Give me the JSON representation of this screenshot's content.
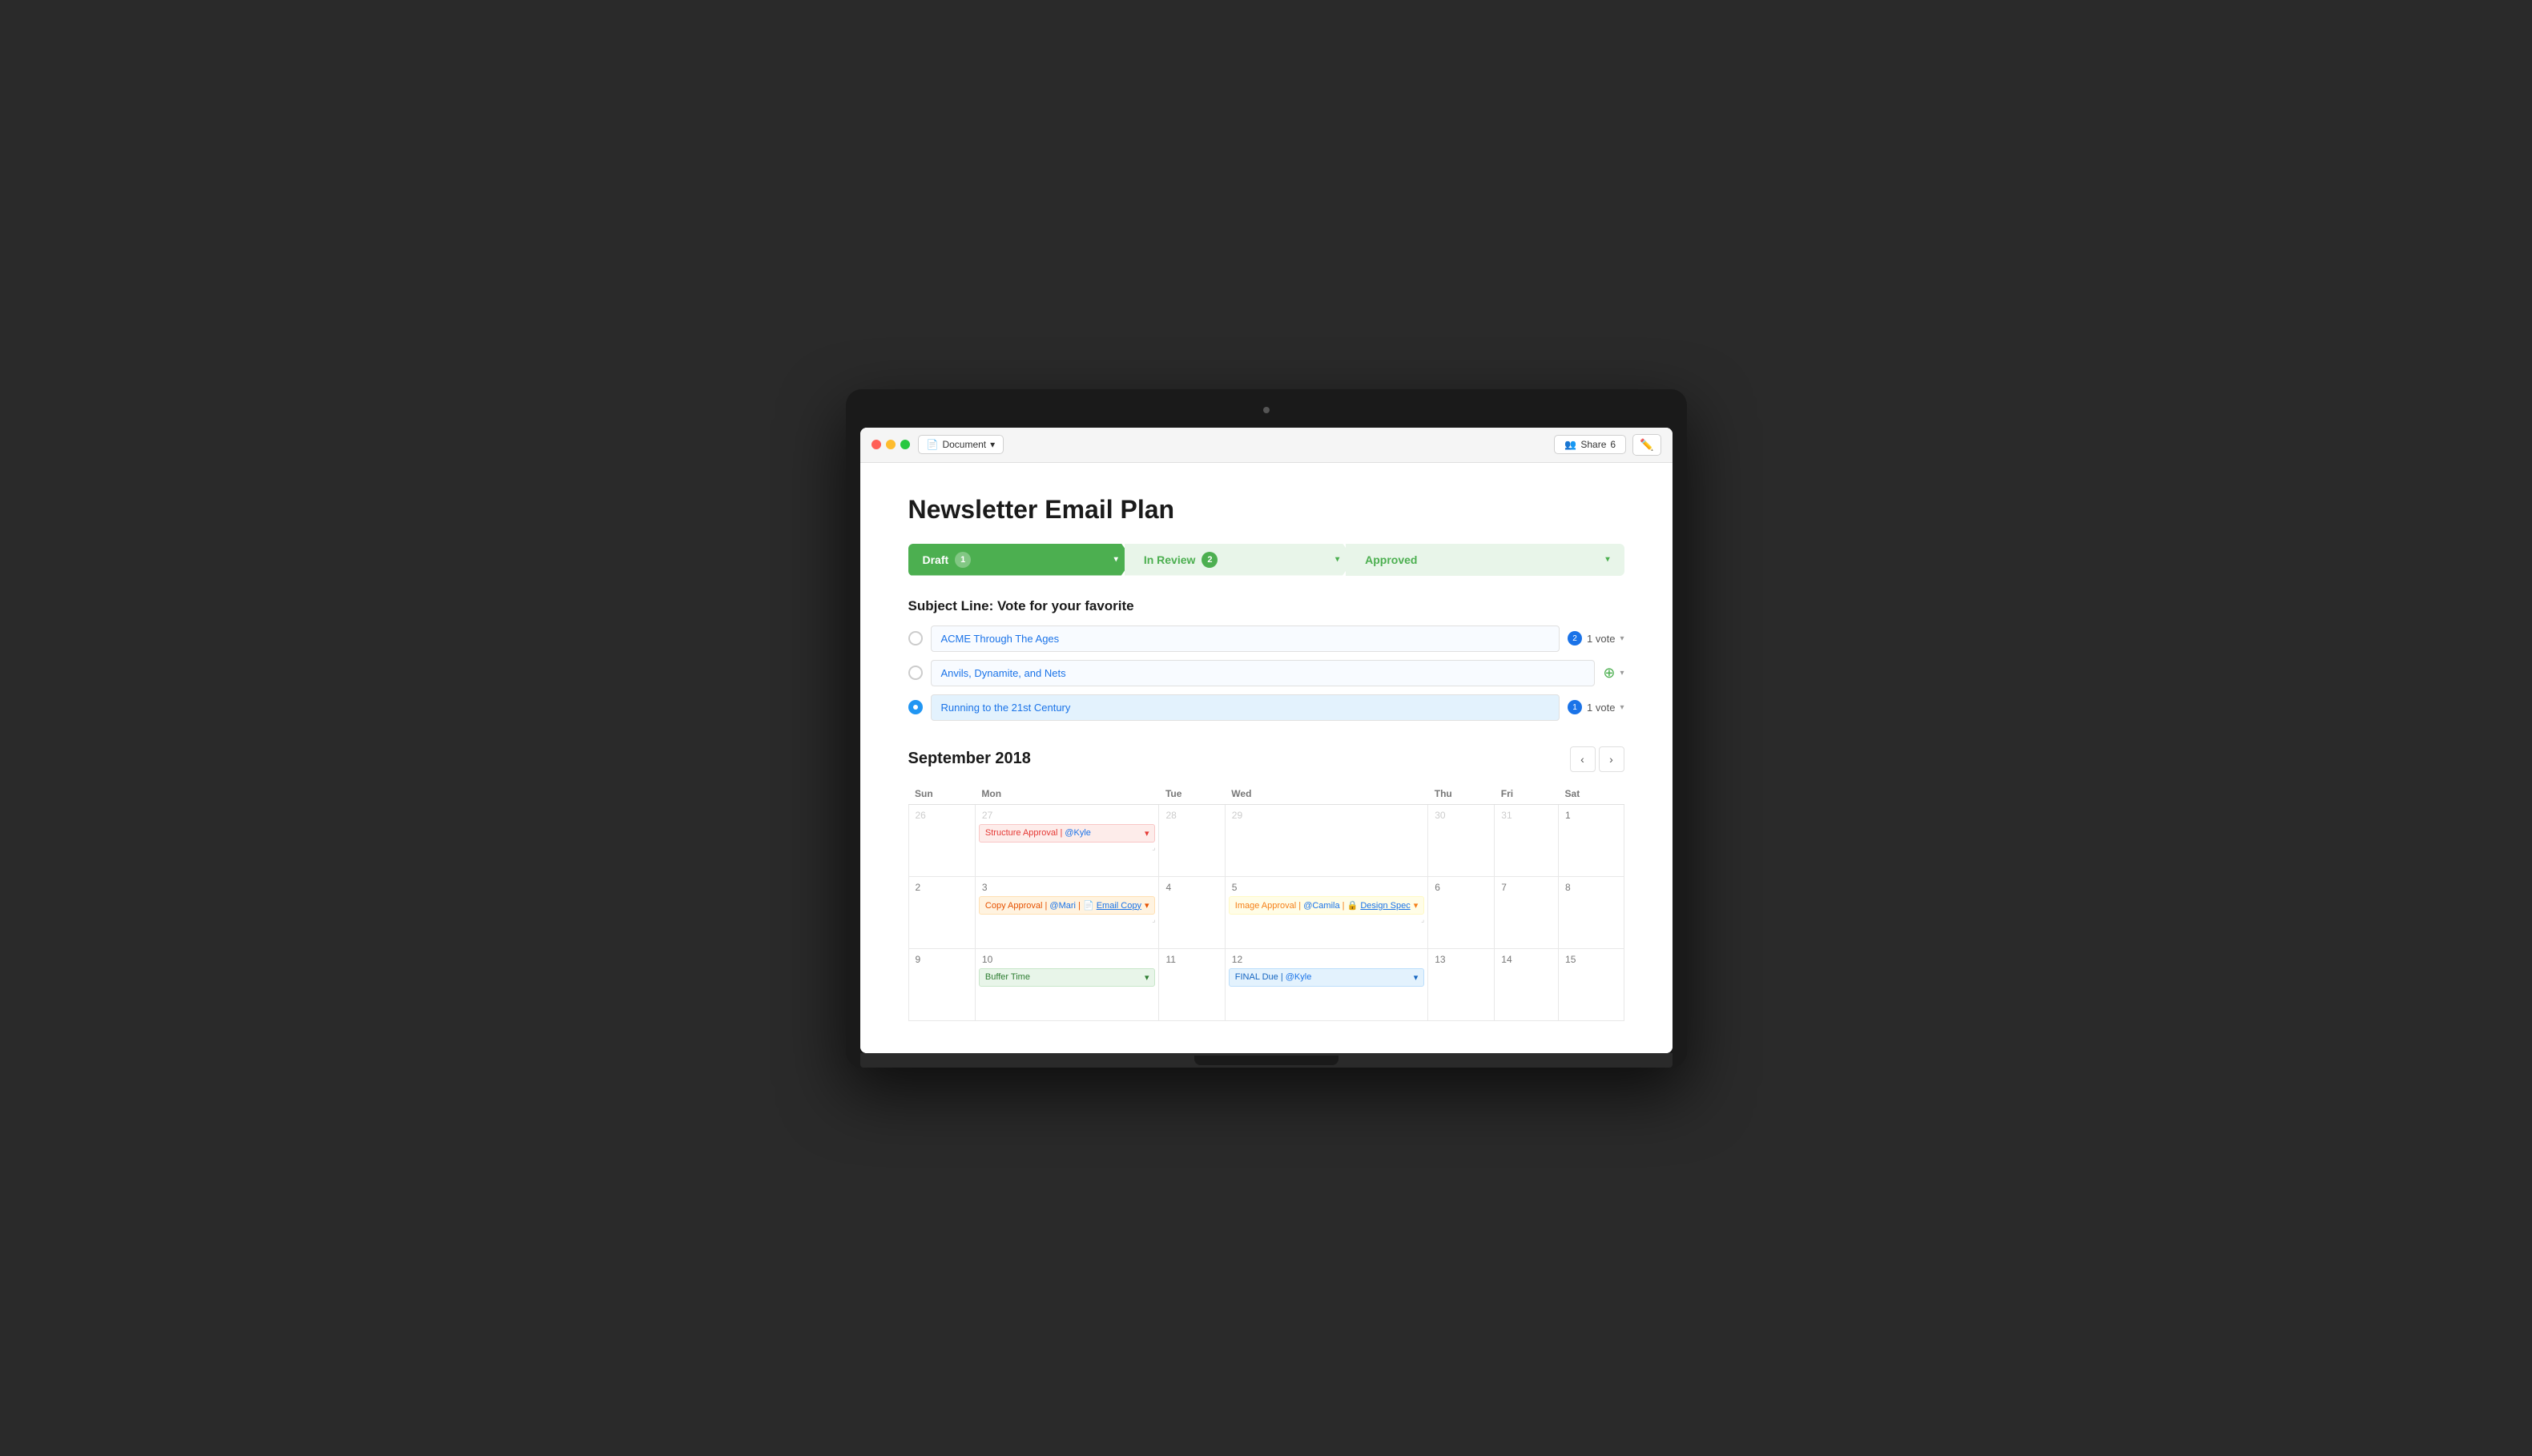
{
  "titlebar": {
    "document_btn": "Document",
    "share_btn": "Share",
    "share_count": "6"
  },
  "page": {
    "title": "Newsletter Email Plan"
  },
  "stages": [
    {
      "id": "draft",
      "label": "Draft",
      "count": "1",
      "style": "active"
    },
    {
      "id": "review",
      "label": "In Review",
      "count": "2",
      "style": "inactive"
    },
    {
      "id": "approved",
      "label": "Approved",
      "count": null,
      "style": "inactive"
    }
  ],
  "subject_section": {
    "title": "Subject Line: Vote for your favorite",
    "options": [
      {
        "id": "opt1",
        "text": "ACME Through The Ages",
        "votes": "1 vote",
        "vote_count": "2",
        "selected": false
      },
      {
        "id": "opt2",
        "text": "Anvils, Dynamite, and Nets",
        "votes": null,
        "vote_count": null,
        "selected": false
      },
      {
        "id": "opt3",
        "text": "Running to the 21st Century",
        "votes": "1 vote",
        "vote_count": "1",
        "selected": true
      }
    ]
  },
  "calendar": {
    "title": "September 2018",
    "days_of_week": [
      "Sun",
      "Mon",
      "Tue",
      "Wed",
      "Thu",
      "Fri",
      "Sat"
    ],
    "weeks": [
      {
        "days": [
          {
            "num": "26",
            "faded": true,
            "events": []
          },
          {
            "num": "27",
            "faded": true,
            "events": [
              {
                "type": "red",
                "text": "Structure Approval | @Kyle",
                "mention": "@Kyle",
                "has_chevron": true
              }
            ]
          },
          {
            "num": "28",
            "faded": true,
            "events": []
          },
          {
            "num": "29",
            "faded": true,
            "events": []
          },
          {
            "num": "30",
            "faded": true,
            "events": []
          },
          {
            "num": "31",
            "faded": true,
            "events": []
          },
          {
            "num": "1",
            "faded": false,
            "events": []
          }
        ]
      },
      {
        "days": [
          {
            "num": "2",
            "faded": false,
            "events": []
          },
          {
            "num": "3",
            "faded": false,
            "events": [
              {
                "type": "orange",
                "text": "Copy Approval | @Mari | 📄 Email Copy",
                "has_chevron": true
              }
            ]
          },
          {
            "num": "4",
            "faded": false,
            "events": []
          },
          {
            "num": "5",
            "faded": false,
            "events": [
              {
                "type": "yellow",
                "text": "Image Approval | @Camila | 🔒 Design Spec",
                "has_chevron": true
              }
            ]
          },
          {
            "num": "6",
            "faded": false,
            "events": []
          },
          {
            "num": "7",
            "faded": false,
            "events": []
          },
          {
            "num": "8",
            "faded": false,
            "events": []
          }
        ]
      },
      {
        "days": [
          {
            "num": "9",
            "faded": false,
            "events": []
          },
          {
            "num": "10",
            "faded": false,
            "events": [
              {
                "type": "green",
                "text": "Buffer Time",
                "has_chevron": true
              }
            ]
          },
          {
            "num": "11",
            "faded": false,
            "events": []
          },
          {
            "num": "12",
            "faded": false,
            "events": [
              {
                "type": "blue",
                "text": "FINAL Due | @Kyle",
                "has_chevron": true
              }
            ]
          },
          {
            "num": "13",
            "faded": false,
            "events": []
          },
          {
            "num": "14",
            "faded": false,
            "events": []
          },
          {
            "num": "15",
            "faded": false,
            "events": []
          }
        ]
      }
    ]
  }
}
